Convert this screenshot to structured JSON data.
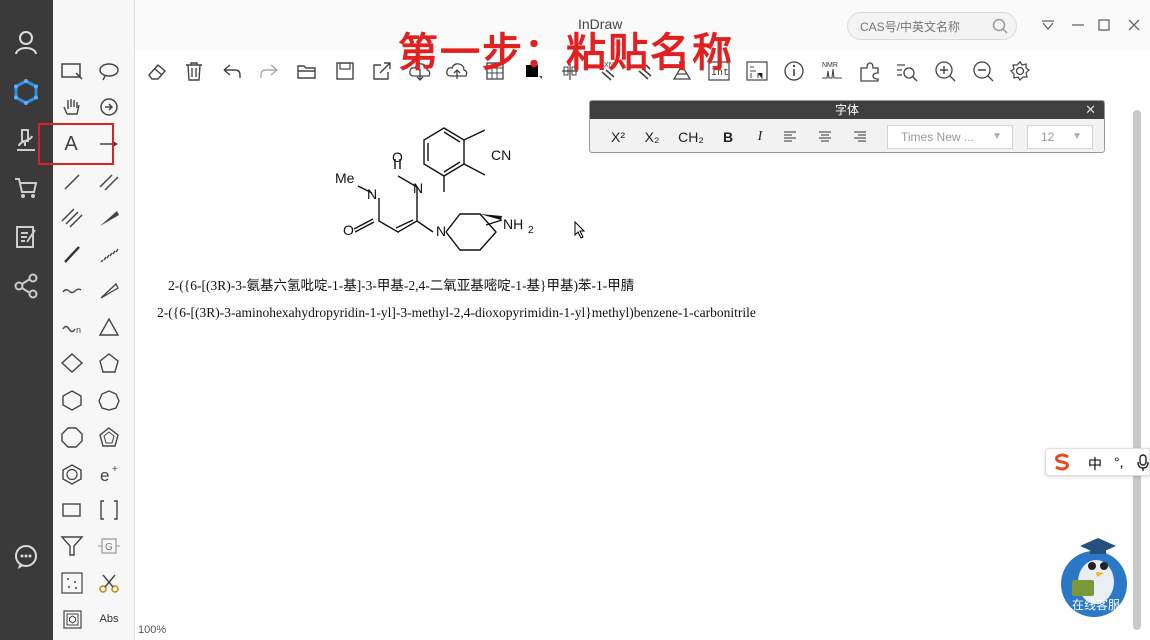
{
  "app": {
    "title": "InDraw",
    "search_placeholder": "CAS号/中英文名称",
    "zoom_level": "100%"
  },
  "annotation": {
    "step_title": "第一步：粘贴名称",
    "highlight_color": "#e02020"
  },
  "nav": {
    "items": [
      {
        "icon": "user-icon"
      },
      {
        "icon": "molecule-logo-icon"
      },
      {
        "icon": "microscope-icon"
      },
      {
        "icon": "cart-icon"
      },
      {
        "icon": "notebook-icon"
      },
      {
        "icon": "share-nodes-icon"
      },
      {
        "icon": "chat-icon"
      }
    ]
  },
  "palette": {
    "text_tool_label": "A",
    "abs_label": "Abs"
  },
  "toolbar": {
    "rxn_label": "RXN",
    "int_label": "Int",
    "nmr_label": "NMR"
  },
  "font_panel": {
    "title": "字体",
    "superscript_label": "X²",
    "subscript_label": "X₂",
    "ch2_label": "CH₂",
    "bold_label": "B",
    "italic_label": "I",
    "font_family_value": "Times New ...",
    "font_size_value": "12"
  },
  "molecule": {
    "labels": {
      "nitrile": "CN",
      "methyl": "Me",
      "n1": "N",
      "n3": "N",
      "n_pip": "N",
      "o_top": "O",
      "o_bottom": "O",
      "amine": "NH",
      "amine_sub": "2"
    }
  },
  "names": {
    "chinese": "2-({6-[(3R)-3-氨基六氢吡啶-1-基]-3-甲基-2,4-二氧亚基嘧啶-1-基}甲基)苯-1-甲腈",
    "english": "2-({6-[(3R)-3-aminohexahydropyridin-1-yl]-3-methyl-2,4-dioxopyrimidin-1-yl}methyl)benzene-1-carbonitrile"
  },
  "ime": {
    "mode_label": "中",
    "punct_label": "°,"
  },
  "service": {
    "label": "在线客服"
  }
}
